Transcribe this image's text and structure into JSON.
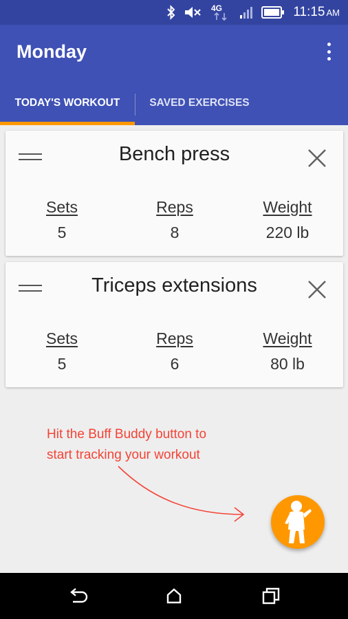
{
  "status_bar": {
    "network": "4G",
    "time": "11:15",
    "ampm": "AM",
    "icons": [
      "bluetooth-icon",
      "mute-icon",
      "network-4g-icon",
      "signal-icon",
      "battery-icon"
    ]
  },
  "app_bar": {
    "title": "Monday",
    "color": "#3f51b5",
    "status_bar_color": "#3344a0",
    "accent_color": "#ff9800"
  },
  "tabs": [
    {
      "label": "TODAY'S WORKOUT",
      "selected": true
    },
    {
      "label": "SAVED EXERCISES",
      "selected": false
    }
  ],
  "exercises": [
    {
      "name": "Bench press",
      "sets_label": "Sets",
      "sets": "5",
      "reps_label": "Reps",
      "reps": "8",
      "weight_label": "Weight",
      "weight": "220 lb"
    },
    {
      "name": "Triceps extensions",
      "sets_label": "Sets",
      "sets": "5",
      "reps_label": "Reps",
      "reps": "6",
      "weight_label": "Weight",
      "weight": "80 lb"
    }
  ],
  "hint": {
    "line1": "Hit the Buff Buddy button to",
    "line2": "start tracking your workout",
    "color": "#f44336"
  },
  "fab": {
    "icon": "buff-buddy-icon",
    "color": "#ff9800"
  },
  "nav_bar": {
    "icons": [
      "back-icon",
      "home-icon",
      "recents-icon"
    ]
  }
}
